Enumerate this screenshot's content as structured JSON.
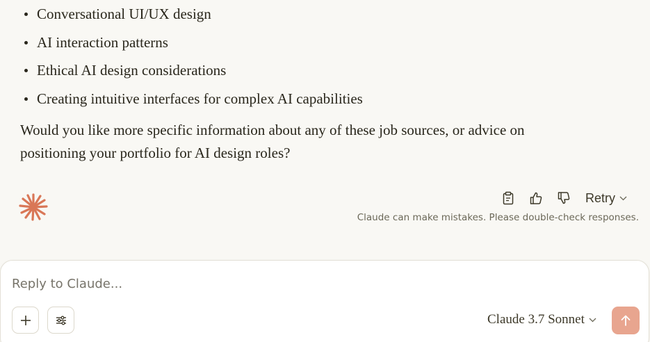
{
  "message": {
    "bullets": [
      "Conversational UI/UX design",
      "AI interaction patterns",
      "Ethical AI design considerations",
      "Creating intuitive interfaces for complex AI capabilities"
    ],
    "closing_line1": "Would you like more specific information about any of these job sources, or advice on",
    "closing_line2": "positioning your portfolio for AI design roles?"
  },
  "actions": {
    "copy_icon": "clipboard-icon",
    "thumbs_up_icon": "thumbs-up-icon",
    "thumbs_down_icon": "thumbs-down-icon",
    "retry_label": "Retry"
  },
  "disclaimer": "Claude can make mistakes. Please double-check responses.",
  "composer": {
    "placeholder": "Reply to Claude...",
    "add_icon": "plus-icon",
    "options_icon": "sliders-icon",
    "model_label": "Claude 3.7 Sonnet",
    "send_icon": "arrow-up-icon"
  },
  "colors": {
    "background": "#f9f8f4",
    "brand": "#d97757",
    "send_button": "#e8a58f",
    "text": "#29261b",
    "muted": "#6b6858"
  }
}
